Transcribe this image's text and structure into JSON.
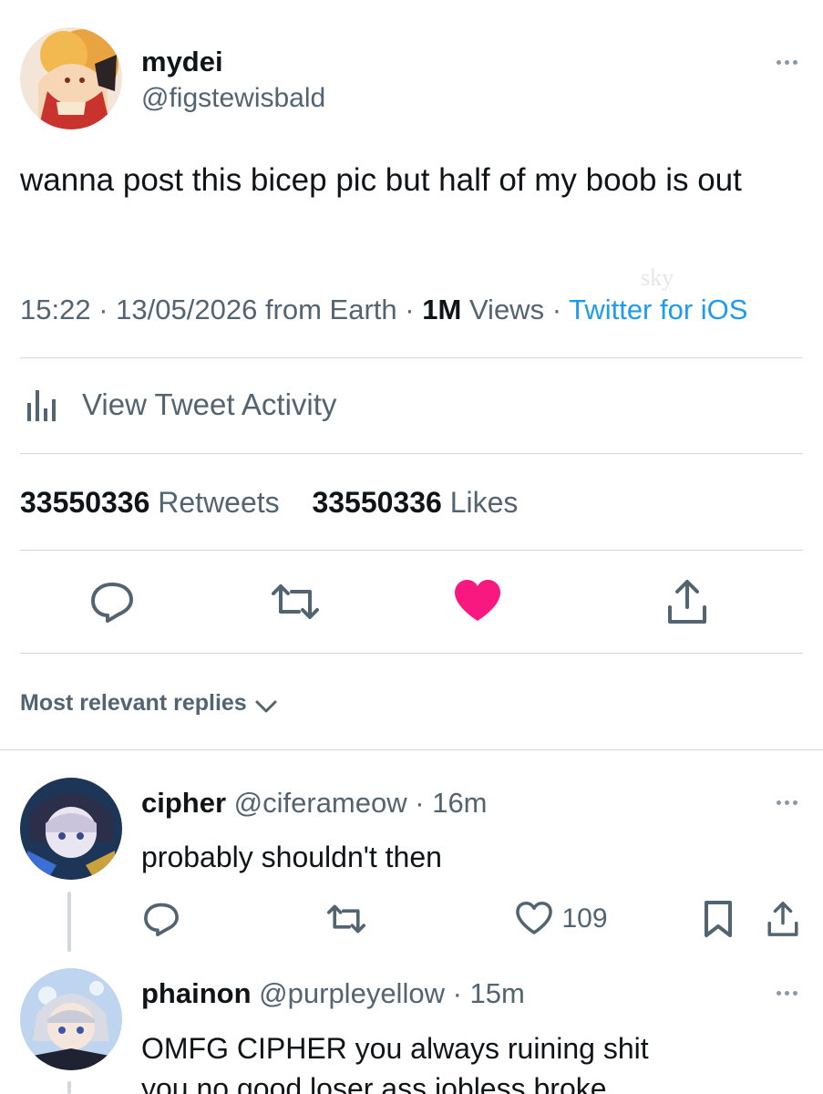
{
  "tweet": {
    "display_name": "mydei",
    "handle": "@figstewisbald",
    "text": "wanna post this bicep pic but half of my boob is out",
    "watermark": "sky",
    "time": "15:22",
    "sep1": "·",
    "date": "13/05/2026",
    "location": "from Earth",
    "sep2": "·",
    "views_count": "1M",
    "views_label": "Views",
    "sep3": "·",
    "client": "Twitter for iOS"
  },
  "activity": {
    "label": "View Tweet Activity",
    "icon": "bar-chart-icon"
  },
  "stats": {
    "retweets_count": "33550336",
    "retweets_label": "Retweets",
    "likes_count": "33550336",
    "likes_label": "Likes"
  },
  "actions": {
    "reply_icon": "reply-icon",
    "retweet_icon": "retweet-icon",
    "like_icon": "heart-filled-icon",
    "share_icon": "share-icon",
    "like_color": "#f91880"
  },
  "replies_sort": {
    "label": "Most relevant replies"
  },
  "replies": [
    {
      "display_name": "cipher",
      "handle": "@ciferameow",
      "sep": "·",
      "age": "16m",
      "text": "probably shouldn't then",
      "likes": "109"
    },
    {
      "display_name": "phainon",
      "handle": "@purpleyellow",
      "sep": "·",
      "age": "15m",
      "text_line1": "OMFG CIPHER you always ruining shit",
      "text_line2": "you no good loser ass jobless broke"
    }
  ],
  "colors": {
    "text": "#0f1419",
    "muted": "#536471",
    "link": "#1d9bf0",
    "divider": "#cfd9de",
    "like": "#f91880"
  }
}
